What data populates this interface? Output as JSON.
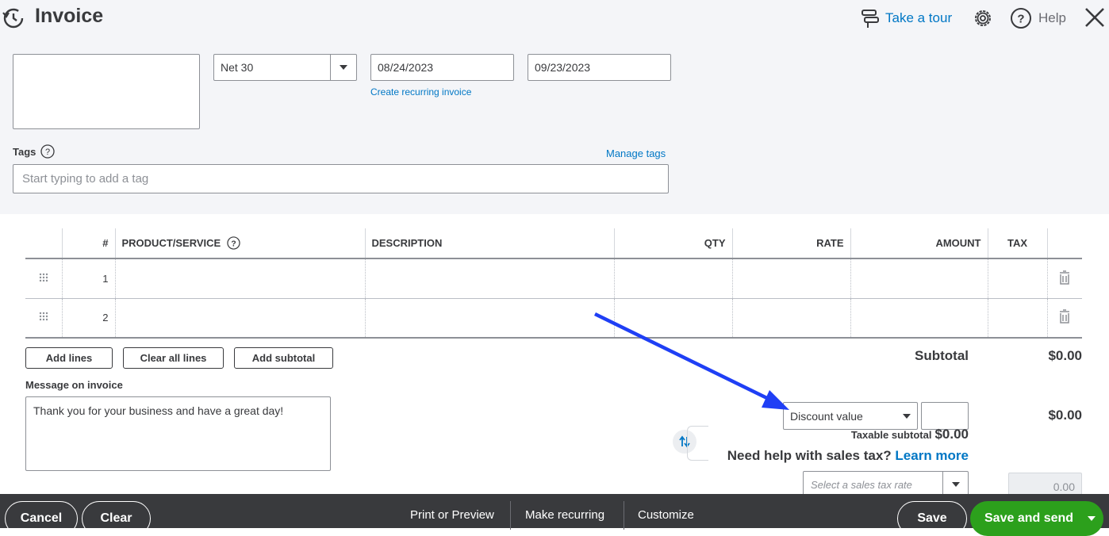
{
  "header": {
    "title": "Invoice",
    "tour_label": "Take a tour",
    "help_label": "Help"
  },
  "customer": {
    "terms": "Net 30",
    "invoice_date": "08/24/2023",
    "due_date": "09/23/2023",
    "recurring_link": "Create recurring invoice"
  },
  "tags": {
    "label": "Tags",
    "manage_label": "Manage tags",
    "placeholder": "Start typing to add a tag"
  },
  "table": {
    "headers": {
      "num": "#",
      "product": "PRODUCT/SERVICE",
      "description": "DESCRIPTION",
      "qty": "QTY",
      "rate": "RATE",
      "amount": "AMOUNT",
      "tax": "TAX"
    },
    "rows": [
      {
        "num": "1"
      },
      {
        "num": "2"
      }
    ]
  },
  "actions": {
    "add_lines": "Add lines",
    "clear_lines": "Clear all lines",
    "add_subtotal": "Add subtotal"
  },
  "totals": {
    "subtotal_label": "Subtotal",
    "subtotal_value": "$0.00",
    "discount_option": "Discount value",
    "discount_total": "$0.00",
    "taxable_label": "Taxable subtotal",
    "taxable_value": "$0.00",
    "sales_tax_help": "Need help with sales tax?",
    "learn_more": "Learn more",
    "tax_rate_placeholder": "Select a sales tax rate",
    "tax_value": "0.00"
  },
  "message": {
    "label": "Message on invoice",
    "text": "Thank you for your business and have a great day!"
  },
  "footer": {
    "cancel": "Cancel",
    "clear": "Clear",
    "print": "Print or Preview",
    "recurring": "Make recurring",
    "customize": "Customize",
    "save": "Save",
    "save_send": "Save and send"
  },
  "colors": {
    "link": "#0077c5",
    "primary": "#2ca01c",
    "footer_bg": "#393a3d",
    "annotation_arrow": "#1f3ff5"
  }
}
